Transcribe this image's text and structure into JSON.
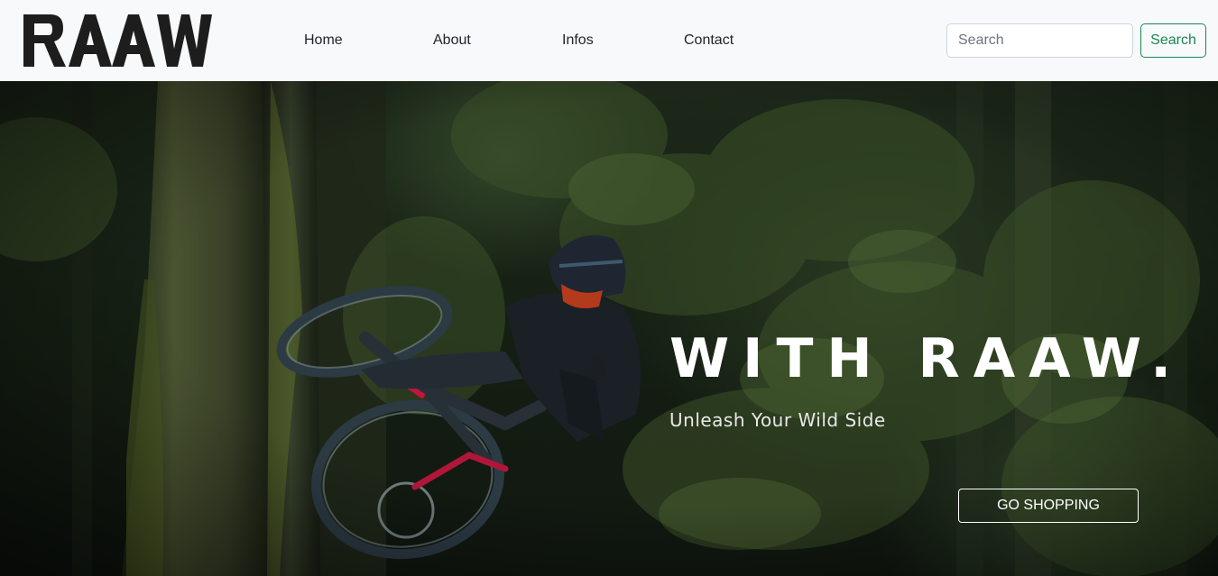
{
  "brand": {
    "logo_text": "RAAW"
  },
  "nav": {
    "items": [
      {
        "label": "Home"
      },
      {
        "label": "About"
      },
      {
        "label": "Infos"
      },
      {
        "label": "Contact"
      }
    ]
  },
  "search": {
    "placeholder": "Search",
    "value": "",
    "button_label": "Search"
  },
  "hero": {
    "title": "WITH RAAW.",
    "subtitle": "Unleash Your Wild Side",
    "cta_label": "GO SHOPPING",
    "image": "mountain biker jumping in a dark pine forest"
  },
  "colors": {
    "navbar_bg": "#f8f9fa",
    "search_accent": "#198754",
    "hero_text": "#ffffff",
    "bike_accent": "#c8123c"
  }
}
